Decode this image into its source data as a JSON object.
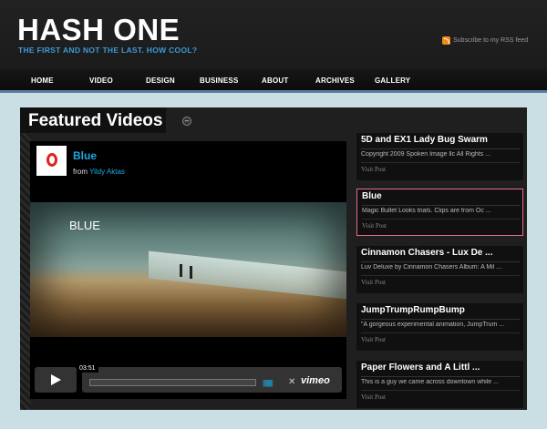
{
  "header": {
    "logo": "HASH ONE",
    "tagline": "THE FIRST AND NOT THE LAST. HOW COOL?",
    "rss_label": "Subscribe to my RSS feed"
  },
  "nav": {
    "items": [
      {
        "label": "HOME"
      },
      {
        "label": "VIDEO"
      },
      {
        "label": "DESIGN"
      },
      {
        "label": "BUSINESS"
      },
      {
        "label": "ABOUT"
      },
      {
        "label": "ARCHIVES"
      },
      {
        "label": "GALLERY"
      }
    ]
  },
  "featured": {
    "heading": "Featured Videos",
    "toggle_symbol": "–",
    "player": {
      "title": "Blue",
      "byline_prefix": "from",
      "author": "Yildy Aktas",
      "frame_caption": "BLUE",
      "time": "03:51",
      "volume_bars": "||||||||||",
      "fullscreen_symbol": "✕",
      "brand": "vimeo"
    },
    "items": [
      {
        "title": "5D and EX1 Lady Bug Swarm",
        "desc": "Copyright 2009 Spoken Image llc All Rights ...",
        "link": "Visit Post"
      },
      {
        "title": "Blue",
        "desc": "Magic Bullet Looks trials. Clips are from Oc ...",
        "link": "Visit Post"
      },
      {
        "title": "Cinnamon Chasers - Lux De ...",
        "desc": "Luv Deluxe by Cinnamon Chasers Album: A Mil ...",
        "link": "Visit Post"
      },
      {
        "title": "JumpTrumpRumpBump",
        "desc": "\"A gorgeous experimental animation, JumpTrum ...",
        "link": "Visit Post"
      },
      {
        "title": "Paper Flowers and A Littl ...",
        "desc": "This is a guy we came across downtown while ...",
        "link": "Visit Post"
      }
    ]
  },
  "colors": {
    "accent_blue": "#1ea7e1",
    "tagline_blue": "#3c9ad6",
    "active_border": "#e46d86",
    "rss_orange": "#f08c1e"
  }
}
